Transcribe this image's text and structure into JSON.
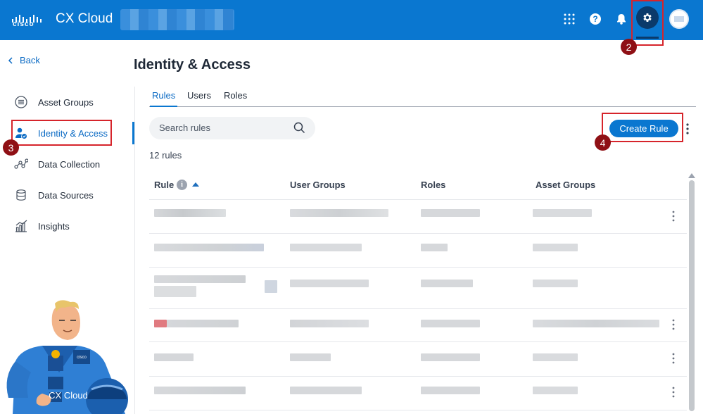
{
  "header": {
    "brand": "cisco",
    "app_title": "CX Cloud",
    "icons": [
      "apps-grid-icon",
      "help-icon",
      "bell-icon",
      "gear-icon",
      "avatar"
    ],
    "help_glyph": "?"
  },
  "colors": {
    "brand_blue": "#0a77d0",
    "dark_navy": "#0b3a6b",
    "callout_red": "#d6242b",
    "callout_badge": "#8f1015"
  },
  "callouts": [
    "2",
    "3",
    "4"
  ],
  "sidebar": {
    "back_label": "Back",
    "items": [
      {
        "label": "Asset Groups",
        "icon": "stack-icon",
        "active": false
      },
      {
        "label": "Identity & Access",
        "icon": "user-check-icon",
        "active": true
      },
      {
        "label": "Data Collection",
        "icon": "nodes-icon",
        "active": false
      },
      {
        "label": "Data Sources",
        "icon": "database-icon",
        "active": false
      },
      {
        "label": "Insights",
        "icon": "bar-chart-icon",
        "active": false
      }
    ]
  },
  "main": {
    "title": "Identity & Access",
    "tabs": [
      {
        "label": "Rules",
        "active": true
      },
      {
        "label": "Users",
        "active": false
      },
      {
        "label": "Roles",
        "active": false
      }
    ],
    "search_placeholder": "Search rules",
    "create_button": "Create Rule",
    "count": "12 rules",
    "columns": [
      "Rule",
      "User Groups",
      "Roles",
      "Asset Groups"
    ],
    "info_glyph": "i",
    "row_count": 6
  },
  "mascot": {
    "label": "CX Cloud",
    "badge": "cisco"
  }
}
